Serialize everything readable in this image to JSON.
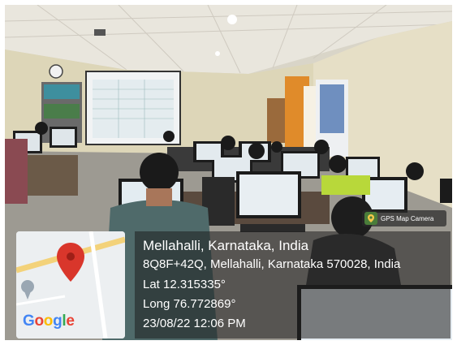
{
  "overlay": {
    "location_title": "Mellahalli, Karnataka, India",
    "address": "8Q8F+42Q, Mellahalli, Karnataka 570028, India",
    "latitude": "Lat 12.315335°",
    "longitude": "Long 76.772869°",
    "datetime": "23/08/22 12:06 PM"
  },
  "badge": {
    "label": "GPS Map Camera",
    "icon": "gps-map-camera-icon"
  },
  "map": {
    "brand": "Google",
    "pin_color": "#d9362b",
    "road_color": "#f3d27a"
  }
}
